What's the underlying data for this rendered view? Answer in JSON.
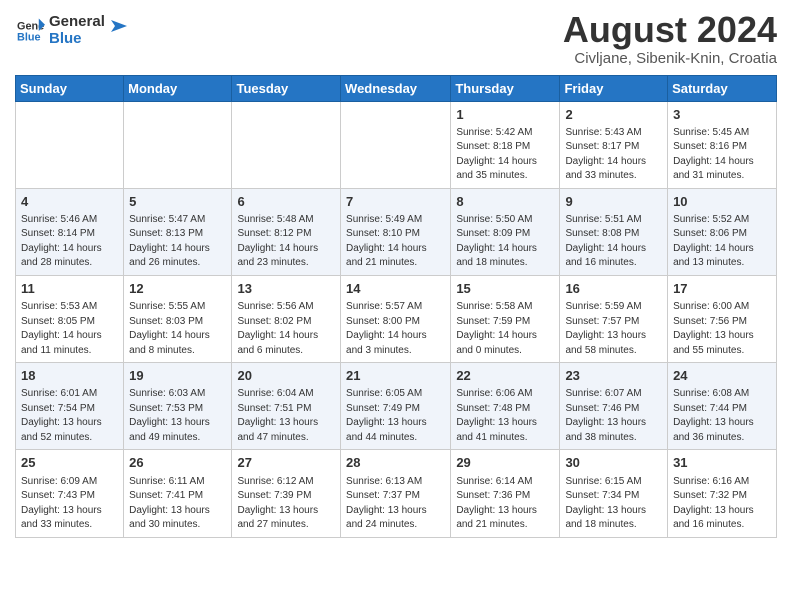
{
  "header": {
    "logo_line1": "General",
    "logo_line2": "Blue",
    "month_year": "August 2024",
    "location": "Civljane, Sibenik-Knin, Croatia"
  },
  "days_of_week": [
    "Sunday",
    "Monday",
    "Tuesday",
    "Wednesday",
    "Thursday",
    "Friday",
    "Saturday"
  ],
  "weeks": [
    [
      {
        "day": "",
        "info": ""
      },
      {
        "day": "",
        "info": ""
      },
      {
        "day": "",
        "info": ""
      },
      {
        "day": "",
        "info": ""
      },
      {
        "day": "1",
        "info": "Sunrise: 5:42 AM\nSunset: 8:18 PM\nDaylight: 14 hours\nand 35 minutes."
      },
      {
        "day": "2",
        "info": "Sunrise: 5:43 AM\nSunset: 8:17 PM\nDaylight: 14 hours\nand 33 minutes."
      },
      {
        "day": "3",
        "info": "Sunrise: 5:45 AM\nSunset: 8:16 PM\nDaylight: 14 hours\nand 31 minutes."
      }
    ],
    [
      {
        "day": "4",
        "info": "Sunrise: 5:46 AM\nSunset: 8:14 PM\nDaylight: 14 hours\nand 28 minutes."
      },
      {
        "day": "5",
        "info": "Sunrise: 5:47 AM\nSunset: 8:13 PM\nDaylight: 14 hours\nand 26 minutes."
      },
      {
        "day": "6",
        "info": "Sunrise: 5:48 AM\nSunset: 8:12 PM\nDaylight: 14 hours\nand 23 minutes."
      },
      {
        "day": "7",
        "info": "Sunrise: 5:49 AM\nSunset: 8:10 PM\nDaylight: 14 hours\nand 21 minutes."
      },
      {
        "day": "8",
        "info": "Sunrise: 5:50 AM\nSunset: 8:09 PM\nDaylight: 14 hours\nand 18 minutes."
      },
      {
        "day": "9",
        "info": "Sunrise: 5:51 AM\nSunset: 8:08 PM\nDaylight: 14 hours\nand 16 minutes."
      },
      {
        "day": "10",
        "info": "Sunrise: 5:52 AM\nSunset: 8:06 PM\nDaylight: 14 hours\nand 13 minutes."
      }
    ],
    [
      {
        "day": "11",
        "info": "Sunrise: 5:53 AM\nSunset: 8:05 PM\nDaylight: 14 hours\nand 11 minutes."
      },
      {
        "day": "12",
        "info": "Sunrise: 5:55 AM\nSunset: 8:03 PM\nDaylight: 14 hours\nand 8 minutes."
      },
      {
        "day": "13",
        "info": "Sunrise: 5:56 AM\nSunset: 8:02 PM\nDaylight: 14 hours\nand 6 minutes."
      },
      {
        "day": "14",
        "info": "Sunrise: 5:57 AM\nSunset: 8:00 PM\nDaylight: 14 hours\nand 3 minutes."
      },
      {
        "day": "15",
        "info": "Sunrise: 5:58 AM\nSunset: 7:59 PM\nDaylight: 14 hours\nand 0 minutes."
      },
      {
        "day": "16",
        "info": "Sunrise: 5:59 AM\nSunset: 7:57 PM\nDaylight: 13 hours\nand 58 minutes."
      },
      {
        "day": "17",
        "info": "Sunrise: 6:00 AM\nSunset: 7:56 PM\nDaylight: 13 hours\nand 55 minutes."
      }
    ],
    [
      {
        "day": "18",
        "info": "Sunrise: 6:01 AM\nSunset: 7:54 PM\nDaylight: 13 hours\nand 52 minutes."
      },
      {
        "day": "19",
        "info": "Sunrise: 6:03 AM\nSunset: 7:53 PM\nDaylight: 13 hours\nand 49 minutes."
      },
      {
        "day": "20",
        "info": "Sunrise: 6:04 AM\nSunset: 7:51 PM\nDaylight: 13 hours\nand 47 minutes."
      },
      {
        "day": "21",
        "info": "Sunrise: 6:05 AM\nSunset: 7:49 PM\nDaylight: 13 hours\nand 44 minutes."
      },
      {
        "day": "22",
        "info": "Sunrise: 6:06 AM\nSunset: 7:48 PM\nDaylight: 13 hours\nand 41 minutes."
      },
      {
        "day": "23",
        "info": "Sunrise: 6:07 AM\nSunset: 7:46 PM\nDaylight: 13 hours\nand 38 minutes."
      },
      {
        "day": "24",
        "info": "Sunrise: 6:08 AM\nSunset: 7:44 PM\nDaylight: 13 hours\nand 36 minutes."
      }
    ],
    [
      {
        "day": "25",
        "info": "Sunrise: 6:09 AM\nSunset: 7:43 PM\nDaylight: 13 hours\nand 33 minutes."
      },
      {
        "day": "26",
        "info": "Sunrise: 6:11 AM\nSunset: 7:41 PM\nDaylight: 13 hours\nand 30 minutes."
      },
      {
        "day": "27",
        "info": "Sunrise: 6:12 AM\nSunset: 7:39 PM\nDaylight: 13 hours\nand 27 minutes."
      },
      {
        "day": "28",
        "info": "Sunrise: 6:13 AM\nSunset: 7:37 PM\nDaylight: 13 hours\nand 24 minutes."
      },
      {
        "day": "29",
        "info": "Sunrise: 6:14 AM\nSunset: 7:36 PM\nDaylight: 13 hours\nand 21 minutes."
      },
      {
        "day": "30",
        "info": "Sunrise: 6:15 AM\nSunset: 7:34 PM\nDaylight: 13 hours\nand 18 minutes."
      },
      {
        "day": "31",
        "info": "Sunrise: 6:16 AM\nSunset: 7:32 PM\nDaylight: 13 hours\nand 16 minutes."
      }
    ]
  ]
}
